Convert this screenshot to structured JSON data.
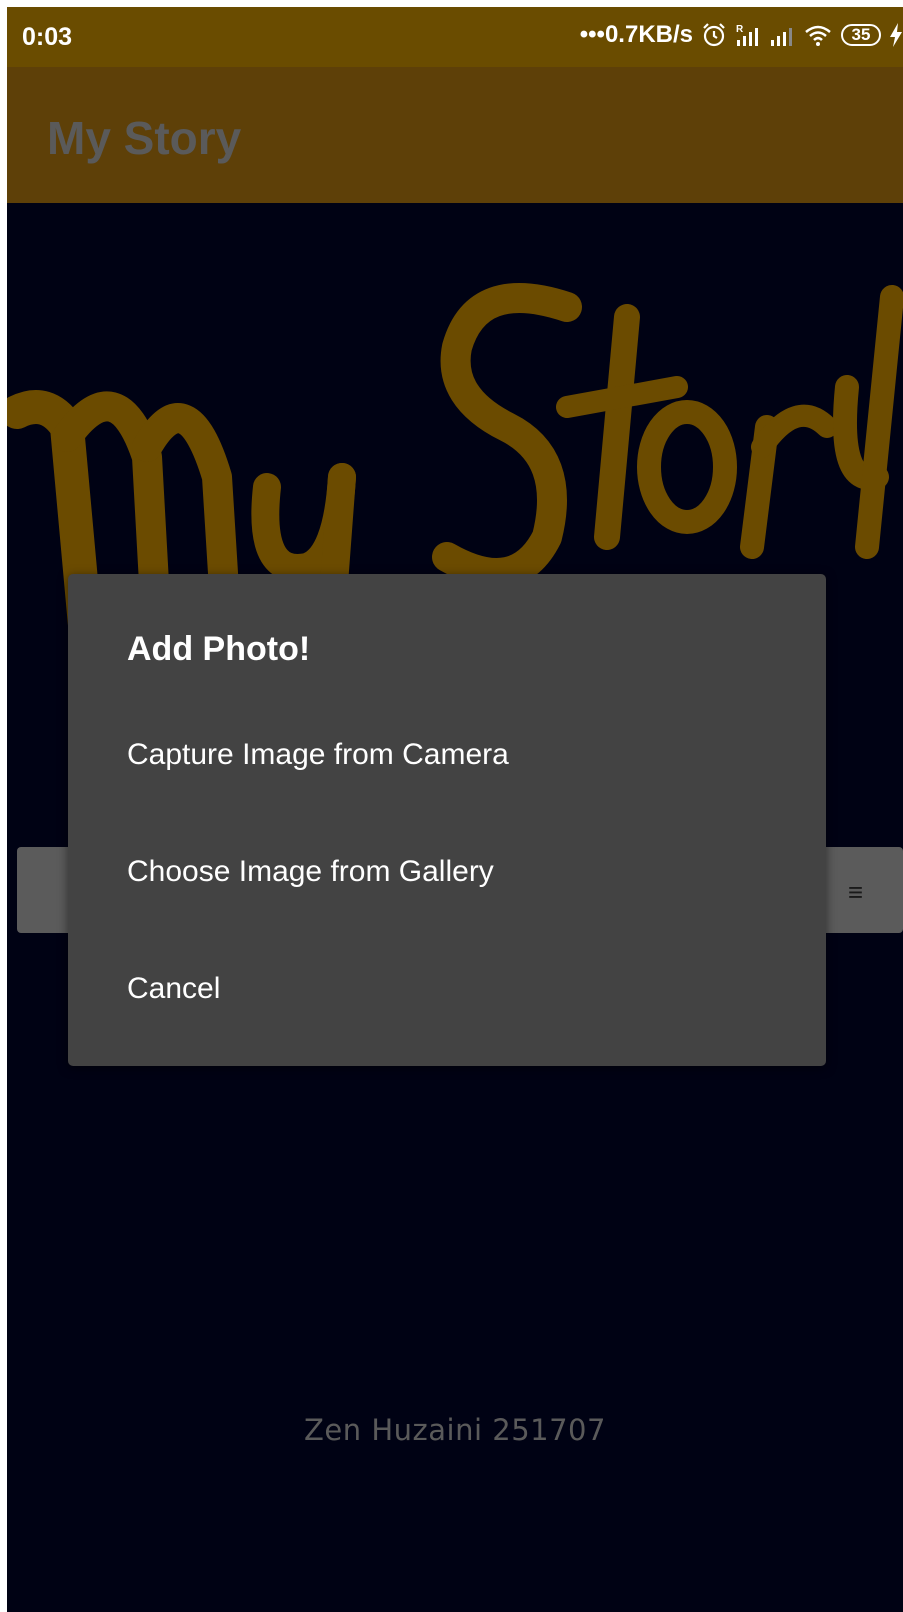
{
  "status_bar": {
    "time": "0:03",
    "network_speed": "•••0.7KB/s",
    "battery_level": "35",
    "icons": [
      "alarm-icon",
      "roaming-signal-icon",
      "signal-icon",
      "wifi-icon",
      "battery-icon",
      "charging-icon"
    ]
  },
  "app_bar": {
    "title": "My Story"
  },
  "logo": {
    "text": "My Story",
    "color": "#6b4b00"
  },
  "dialog": {
    "title": "Add Photo!",
    "options": [
      "Capture Image from Camera",
      "Choose Image from Gallery",
      "Cancel"
    ]
  },
  "footer": {
    "credit": "Zen Huzaini 251707"
  },
  "colors": {
    "status_bar": "#6a4c00",
    "app_bar": "#5e4008",
    "background": "#000214",
    "dialog": "#434343",
    "text_primary": "#ffffff",
    "text_muted": "#5a5a5a"
  }
}
